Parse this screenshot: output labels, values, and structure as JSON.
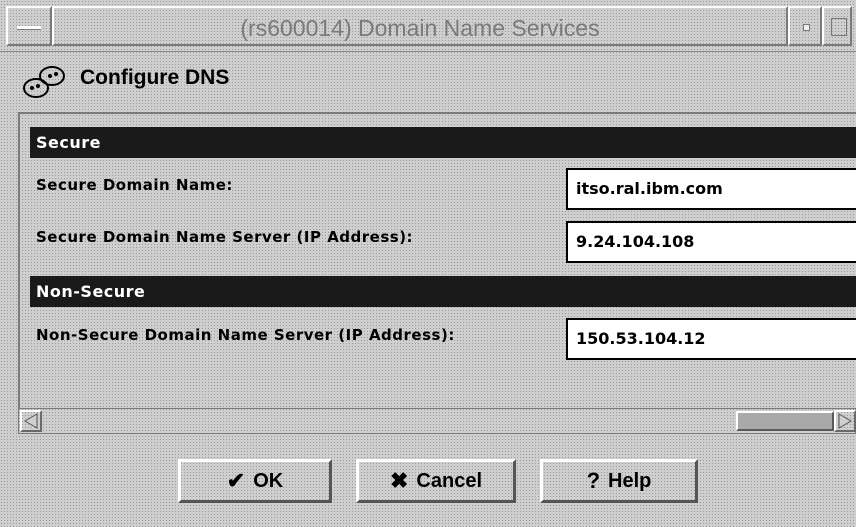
{
  "window": {
    "title": "(rs600014) Domain Name Services"
  },
  "header": {
    "label": "Configure DNS",
    "icon": "dns-config-icon"
  },
  "sections": {
    "secure": {
      "title": "Secure",
      "domain_name_label": "Secure Domain Name:",
      "domain_name_value": "itso.ral.ibm.com",
      "server_label": "Secure Domain Name Server (IP Address):",
      "server_value": "9.24.104.108"
    },
    "nonsecure": {
      "title": "Non-Secure",
      "server_label": "Non-Secure Domain Name Server (IP Address):",
      "server_value": "150.53.104.12"
    }
  },
  "buttons": {
    "ok": "OK",
    "cancel": "Cancel",
    "help": "Help"
  },
  "icons": {
    "ok": "checkmark-icon",
    "cancel": "x-icon",
    "help": "question-icon"
  },
  "colors": {
    "section_bar": "#1a1a1a",
    "background": "#cfcfcf"
  }
}
